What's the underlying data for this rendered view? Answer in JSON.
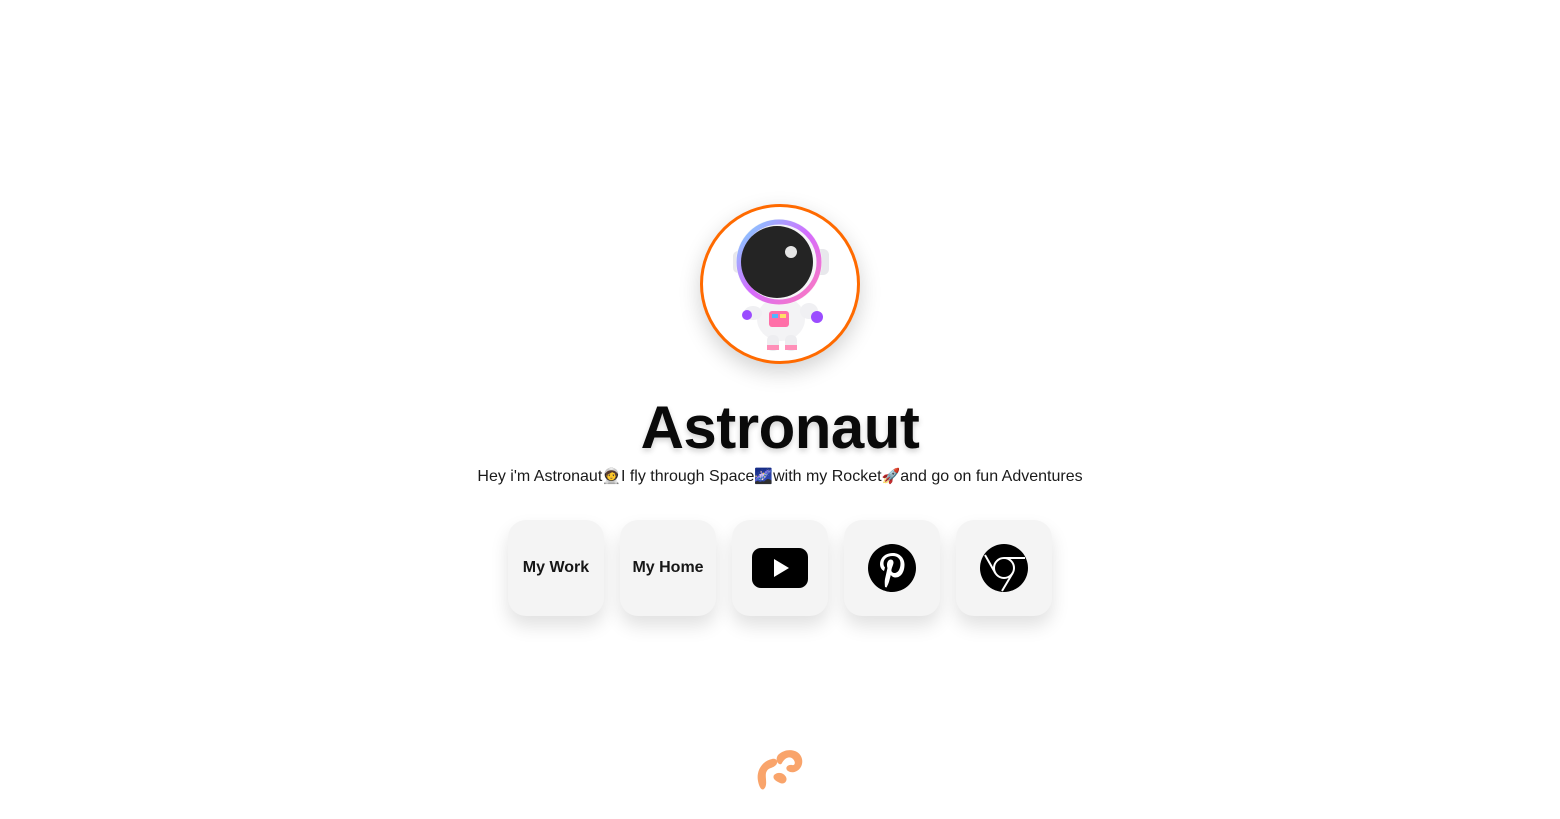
{
  "profile": {
    "name": "Astronaut",
    "avatar_icon": "astronaut-avatar",
    "bio": {
      "part1": "Hey i'm Astronaut",
      "emoji1": "🧑‍🚀",
      "part2": "I fly through Space",
      "emoji2": "🌌",
      "part3": "with my Rocket",
      "emoji3": "🚀",
      "part4": "and go on fun Adventures"
    }
  },
  "links": [
    {
      "label": "My Work"
    },
    {
      "label": "My Home"
    },
    {
      "icon": "youtube-icon"
    },
    {
      "icon": "pinterest-icon"
    },
    {
      "icon": "chrome-icon"
    }
  ],
  "footer": {
    "logo_icon": "brand-logo-icon"
  },
  "colors": {
    "accent": "#ff6a00",
    "card_bg": "#f4f4f4",
    "logo": "#f9a46b"
  }
}
